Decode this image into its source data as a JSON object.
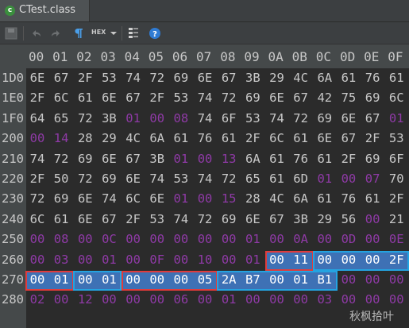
{
  "tab": {
    "title": "CTest.class"
  },
  "toolbar": {
    "hex_label": "HEX"
  },
  "columns": [
    "00",
    "01",
    "02",
    "03",
    "04",
    "05",
    "06",
    "07",
    "08",
    "09",
    "0A",
    "0B",
    "0C",
    "0D",
    "0E",
    "0F"
  ],
  "rows": [
    {
      "addr": "1D0",
      "cells": [
        [
          "6E",
          "n"
        ],
        [
          "67",
          "n"
        ],
        [
          "2F",
          "n"
        ],
        [
          "53",
          "n"
        ],
        [
          "74",
          "n"
        ],
        [
          "72",
          "n"
        ],
        [
          "69",
          "n"
        ],
        [
          "6E",
          "n"
        ],
        [
          "67",
          "n"
        ],
        [
          "3B",
          "n"
        ],
        [
          "29",
          "n"
        ],
        [
          "4C",
          "n"
        ],
        [
          "6A",
          "n"
        ],
        [
          "61",
          "n"
        ],
        [
          "76",
          "n"
        ],
        [
          "61",
          "n"
        ]
      ]
    },
    {
      "addr": "1E0",
      "cells": [
        [
          "2F",
          "n"
        ],
        [
          "6C",
          "n"
        ],
        [
          "61",
          "n"
        ],
        [
          "6E",
          "n"
        ],
        [
          "67",
          "n"
        ],
        [
          "2F",
          "n"
        ],
        [
          "53",
          "n"
        ],
        [
          "74",
          "n"
        ],
        [
          "72",
          "n"
        ],
        [
          "69",
          "n"
        ],
        [
          "6E",
          "n"
        ],
        [
          "67",
          "n"
        ],
        [
          "42",
          "n"
        ],
        [
          "75",
          "n"
        ],
        [
          "69",
          "n"
        ],
        [
          "6C",
          "n"
        ]
      ]
    },
    {
      "addr": "1F0",
      "cells": [
        [
          "64",
          "n"
        ],
        [
          "65",
          "n"
        ],
        [
          "72",
          "n"
        ],
        [
          "3B",
          "n"
        ],
        [
          "01",
          "p"
        ],
        [
          "00",
          "p"
        ],
        [
          "08",
          "p"
        ],
        [
          "74",
          "n"
        ],
        [
          "6F",
          "n"
        ],
        [
          "53",
          "n"
        ],
        [
          "74",
          "n"
        ],
        [
          "72",
          "n"
        ],
        [
          "69",
          "n"
        ],
        [
          "6E",
          "n"
        ],
        [
          "67",
          "n"
        ],
        [
          "01",
          "p"
        ]
      ]
    },
    {
      "addr": "200",
      "cells": [
        [
          "00",
          "p"
        ],
        [
          "14",
          "p"
        ],
        [
          "28",
          "n"
        ],
        [
          "29",
          "n"
        ],
        [
          "4C",
          "n"
        ],
        [
          "6A",
          "n"
        ],
        [
          "61",
          "n"
        ],
        [
          "76",
          "n"
        ],
        [
          "61",
          "n"
        ],
        [
          "2F",
          "n"
        ],
        [
          "6C",
          "n"
        ],
        [
          "61",
          "n"
        ],
        [
          "6E",
          "n"
        ],
        [
          "67",
          "n"
        ],
        [
          "2F",
          "n"
        ],
        [
          "53",
          "n"
        ]
      ]
    },
    {
      "addr": "210",
      "cells": [
        [
          "74",
          "n"
        ],
        [
          "72",
          "n"
        ],
        [
          "69",
          "n"
        ],
        [
          "6E",
          "n"
        ],
        [
          "67",
          "n"
        ],
        [
          "3B",
          "n"
        ],
        [
          "01",
          "p"
        ],
        [
          "00",
          "p"
        ],
        [
          "13",
          "p"
        ],
        [
          "6A",
          "n"
        ],
        [
          "61",
          "n"
        ],
        [
          "76",
          "n"
        ],
        [
          "61",
          "n"
        ],
        [
          "2F",
          "n"
        ],
        [
          "69",
          "n"
        ],
        [
          "6F",
          "n"
        ]
      ]
    },
    {
      "addr": "220",
      "cells": [
        [
          "2F",
          "n"
        ],
        [
          "50",
          "n"
        ],
        [
          "72",
          "n"
        ],
        [
          "69",
          "n"
        ],
        [
          "6E",
          "n"
        ],
        [
          "74",
          "n"
        ],
        [
          "53",
          "n"
        ],
        [
          "74",
          "n"
        ],
        [
          "72",
          "n"
        ],
        [
          "65",
          "n"
        ],
        [
          "61",
          "n"
        ],
        [
          "6D",
          "n"
        ],
        [
          "01",
          "p"
        ],
        [
          "00",
          "p"
        ],
        [
          "07",
          "p"
        ],
        [
          "70",
          "n"
        ]
      ]
    },
    {
      "addr": "230",
      "cells": [
        [
          "72",
          "n"
        ],
        [
          "69",
          "n"
        ],
        [
          "6E",
          "n"
        ],
        [
          "74",
          "n"
        ],
        [
          "6C",
          "n"
        ],
        [
          "6E",
          "n"
        ],
        [
          "01",
          "p"
        ],
        [
          "00",
          "p"
        ],
        [
          "15",
          "p"
        ],
        [
          "28",
          "n"
        ],
        [
          "4C",
          "n"
        ],
        [
          "6A",
          "n"
        ],
        [
          "61",
          "n"
        ],
        [
          "76",
          "n"
        ],
        [
          "61",
          "n"
        ],
        [
          "2F",
          "n"
        ]
      ]
    },
    {
      "addr": "240",
      "cells": [
        [
          "6C",
          "n"
        ],
        [
          "61",
          "n"
        ],
        [
          "6E",
          "n"
        ],
        [
          "67",
          "n"
        ],
        [
          "2F",
          "n"
        ],
        [
          "53",
          "n"
        ],
        [
          "74",
          "n"
        ],
        [
          "72",
          "n"
        ],
        [
          "69",
          "n"
        ],
        [
          "6E",
          "n"
        ],
        [
          "67",
          "n"
        ],
        [
          "3B",
          "n"
        ],
        [
          "29",
          "n"
        ],
        [
          "56",
          "n"
        ],
        [
          "00",
          "p"
        ],
        [
          "21",
          "n"
        ]
      ]
    },
    {
      "addr": "250",
      "cells": [
        [
          "00",
          "p"
        ],
        [
          "08",
          "p"
        ],
        [
          "00",
          "p"
        ],
        [
          "0C",
          "p"
        ],
        [
          "00",
          "p"
        ],
        [
          "00",
          "p"
        ],
        [
          "00",
          "p"
        ],
        [
          "00",
          "p"
        ],
        [
          "00",
          "p"
        ],
        [
          "01",
          "p"
        ],
        [
          "00",
          "p"
        ],
        [
          "0A",
          "p"
        ],
        [
          "00",
          "p"
        ],
        [
          "0D",
          "p"
        ],
        [
          "00",
          "p"
        ],
        [
          "0E",
          "p"
        ]
      ]
    },
    {
      "addr": "260",
      "cells": [
        [
          "00",
          "p"
        ],
        [
          "03",
          "p"
        ],
        [
          "00",
          "p"
        ],
        [
          "01",
          "p"
        ],
        [
          "00",
          "p"
        ],
        [
          "0F",
          "p"
        ],
        [
          "00",
          "p"
        ],
        [
          "10",
          "p"
        ],
        [
          "00",
          "p"
        ],
        [
          "01",
          "p"
        ],
        [
          "00",
          "sel"
        ],
        [
          "11",
          "sel"
        ],
        [
          "00",
          "sel"
        ],
        [
          "00",
          "sel"
        ],
        [
          "00",
          "sel"
        ],
        [
          "2F",
          "sel"
        ]
      ]
    },
    {
      "addr": "270",
      "cells": [
        [
          "00",
          "sel"
        ],
        [
          "01",
          "sel"
        ],
        [
          "00",
          "sel"
        ],
        [
          "01",
          "sel"
        ],
        [
          "00",
          "sel"
        ],
        [
          "00",
          "sel"
        ],
        [
          "00",
          "sel"
        ],
        [
          "05",
          "sel"
        ],
        [
          "2A",
          "sel"
        ],
        [
          "B7",
          "sel"
        ],
        [
          "00",
          "sel"
        ],
        [
          "01",
          "sel"
        ],
        [
          "B1",
          "sel"
        ],
        [
          "00",
          "p"
        ],
        [
          "00",
          "p"
        ],
        [
          "00",
          "p"
        ]
      ]
    },
    {
      "addr": "280",
      "cells": [
        [
          "02",
          "p"
        ],
        [
          "00",
          "p"
        ],
        [
          "12",
          "p"
        ],
        [
          "00",
          "p"
        ],
        [
          "00",
          "p"
        ],
        [
          "00",
          "p"
        ],
        [
          "06",
          "p"
        ],
        [
          "00",
          "p"
        ],
        [
          "01",
          "p"
        ],
        [
          "00",
          "p"
        ],
        [
          "00",
          "p"
        ],
        [
          "00",
          "p"
        ],
        [
          "03",
          "p"
        ],
        [
          "00",
          "p"
        ],
        [
          "00",
          "p"
        ],
        [
          "00",
          "p"
        ]
      ]
    }
  ],
  "watermark": "秋枫拾叶",
  "colors": {
    "normal": "#c8c8c8",
    "purple": "#8f3aa6",
    "selection": "#3e71b5",
    "red_box": "#e03b3b",
    "blue_box": "#24a3e0"
  }
}
